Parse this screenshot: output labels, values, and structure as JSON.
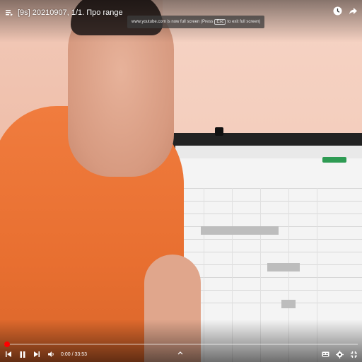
{
  "video": {
    "title": "[9s] 20210907, 1/1. Про range",
    "fullscreen_toast": {
      "before_key": "www.youtube.com is now full screen (Press",
      "key": "Esc",
      "after_key": "to exit full screen)"
    }
  },
  "player": {
    "current_time": "0:00",
    "separator": "/",
    "duration": "33:53",
    "progress": 0.0
  },
  "icons": {
    "playlist": "playlist-icon",
    "watch_later": "clock-icon",
    "share": "share-icon",
    "skip_back": "skip-previous-icon",
    "pause": "pause-icon",
    "skip_next": "skip-next-icon",
    "volume": "volume-icon",
    "chevron": "chevron-up-icon",
    "subtitles": "subtitles-icon",
    "settings": "gear-icon",
    "fullscreen": "exit-fullscreen-icon"
  },
  "colors": {
    "progress": "#ff0000",
    "shirt": "#f07c3e"
  }
}
